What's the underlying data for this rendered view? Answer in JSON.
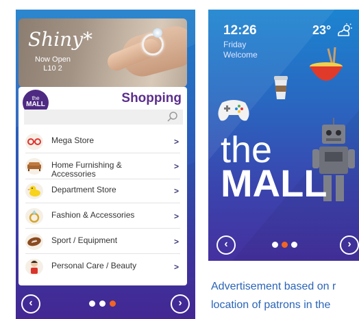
{
  "left_screen": {
    "ad": {
      "title": "Shiny*",
      "line1": "Now Open",
      "line2": "L10 2"
    },
    "logo": {
      "small": "the",
      "big": "MALL"
    },
    "section_title": "Shopping",
    "search": {
      "icon": "search-icon"
    },
    "categories": [
      {
        "label": "Mega Store",
        "icon": "glasses-icon"
      },
      {
        "label": "Home Furnishing & Accessories",
        "icon": "sofa-icon"
      },
      {
        "label": "Department Store",
        "icon": "duck-toy-icon"
      },
      {
        "label": "Fashion & Accessories",
        "icon": "ring-icon"
      },
      {
        "label": "Sport / Equipment",
        "icon": "football-icon"
      },
      {
        "label": "Personal Care / Beauty",
        "icon": "person-icon"
      }
    ],
    "nav": {
      "prev": "‹",
      "next": "›",
      "active_dot": 2
    }
  },
  "right_screen": {
    "time": "12:26",
    "day": "Friday",
    "greeting": "Welcome",
    "temperature": "23°",
    "weather_icon": "partly-cloudy-icon",
    "brand_small": "the",
    "brand_big": "MALL",
    "nav": {
      "prev": "‹",
      "next": "›",
      "active_dot": 1
    }
  },
  "caption": {
    "line1": "Advertisement based on r",
    "line2": "location of patrons in the"
  },
  "colors": {
    "dot_inactive": "#ffffff",
    "dot_active": "#f26522",
    "brand_purple": "#5b2e8c",
    "caption_blue": "#2a64b7"
  }
}
